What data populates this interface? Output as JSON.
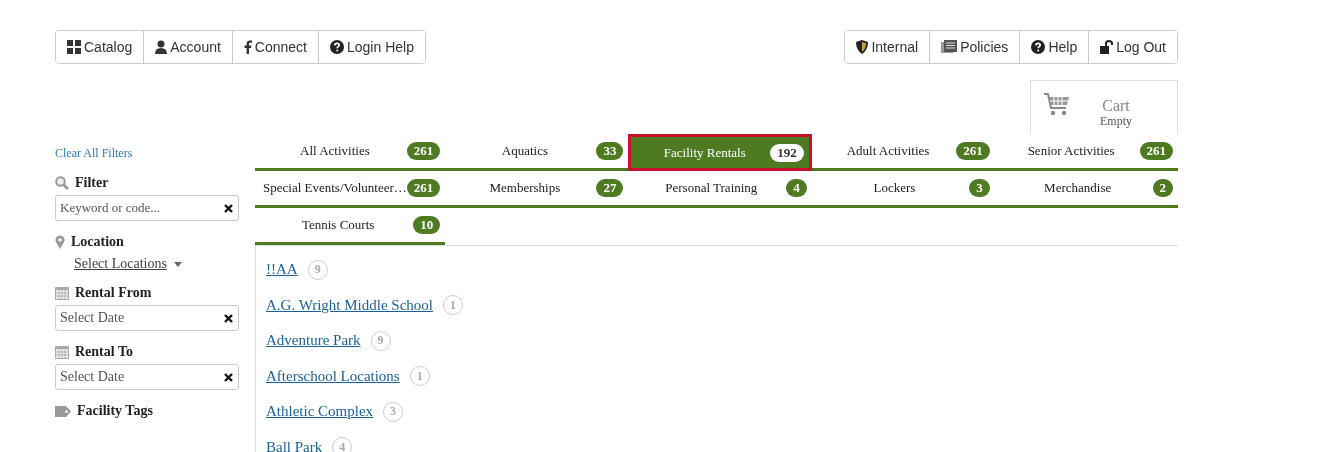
{
  "nav_left": [
    {
      "label": "Catalog"
    },
    {
      "label": "Account"
    },
    {
      "label": "Connect"
    },
    {
      "label": "Login Help"
    }
  ],
  "nav_right": [
    {
      "label": "Internal"
    },
    {
      "label": "Policies"
    },
    {
      "label": "Help"
    },
    {
      "label": "Log Out"
    }
  ],
  "cart": {
    "title": "Cart",
    "status": "Empty"
  },
  "sidebar": {
    "clear_link": "Clear All Filters",
    "filters": [
      {
        "kind": "text",
        "label": "Filter",
        "placeholder": "Keyword or code..."
      },
      {
        "kind": "dropdown",
        "label": "Location",
        "value": "Select Locations"
      },
      {
        "kind": "date",
        "label": "Rental From",
        "placeholder": "Select Date"
      },
      {
        "kind": "date",
        "label": "Rental To",
        "placeholder": "Select Date"
      },
      {
        "kind": "tags",
        "label": "Facility Tags"
      }
    ]
  },
  "tabs": [
    {
      "label": "All Activities",
      "count": "261",
      "selected": false
    },
    {
      "label": "Aquatics",
      "count": "33",
      "selected": false
    },
    {
      "label": "Facility Rentals",
      "count": "192",
      "selected": true
    },
    {
      "label": "Adult Activities",
      "count": "261",
      "selected": false
    },
    {
      "label": "Senior Activities",
      "count": "261",
      "selected": false
    },
    {
      "label": "Special Events/Volunteer…",
      "count": "261",
      "selected": false
    },
    {
      "label": "Memberships",
      "count": "27",
      "selected": false
    },
    {
      "label": "Personal Training",
      "count": "4",
      "selected": false
    },
    {
      "label": "Lockers",
      "count": "3",
      "selected": false
    },
    {
      "label": "Merchandise",
      "count": "2",
      "selected": false
    },
    {
      "label": "Tennis Courts",
      "count": "10",
      "selected": false
    }
  ],
  "facilities": [
    {
      "name": "!!AA",
      "count": "9"
    },
    {
      "name": "A.G. Wright Middle School",
      "count": "1"
    },
    {
      "name": "Adventure Park",
      "count": "9"
    },
    {
      "name": "Afterschool Locations",
      "count": "1"
    },
    {
      "name": "Athletic Complex",
      "count": "3"
    },
    {
      "name": "Ball Park",
      "count": "4"
    }
  ]
}
